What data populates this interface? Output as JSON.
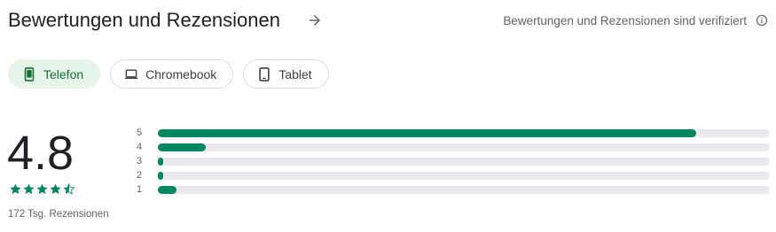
{
  "header": {
    "title": "Bewertungen und Rezensionen",
    "verified_text": "Bewertungen und Rezensionen sind verifiziert"
  },
  "chips": [
    {
      "label": "Telefon",
      "icon": "phone-icon",
      "active": true
    },
    {
      "label": "Chromebook",
      "icon": "laptop-icon",
      "active": false
    },
    {
      "label": "Tablet",
      "icon": "tablet-icon",
      "active": false
    }
  ],
  "rating": {
    "score": "4.8",
    "stars": 4.5,
    "reviews_count": "172 Tsg. Rezensionen"
  },
  "distribution": [
    {
      "label": "5",
      "fraction": 0.88
    },
    {
      "label": "4",
      "fraction": 0.078
    },
    {
      "label": "3",
      "fraction": 0.009
    },
    {
      "label": "2",
      "fraction": 0.005
    },
    {
      "label": "1",
      "fraction": 0.03
    }
  ],
  "colors": {
    "accent": "#01875f",
    "chip_active_bg": "#e6f4ea",
    "track": "#e8eaed"
  }
}
